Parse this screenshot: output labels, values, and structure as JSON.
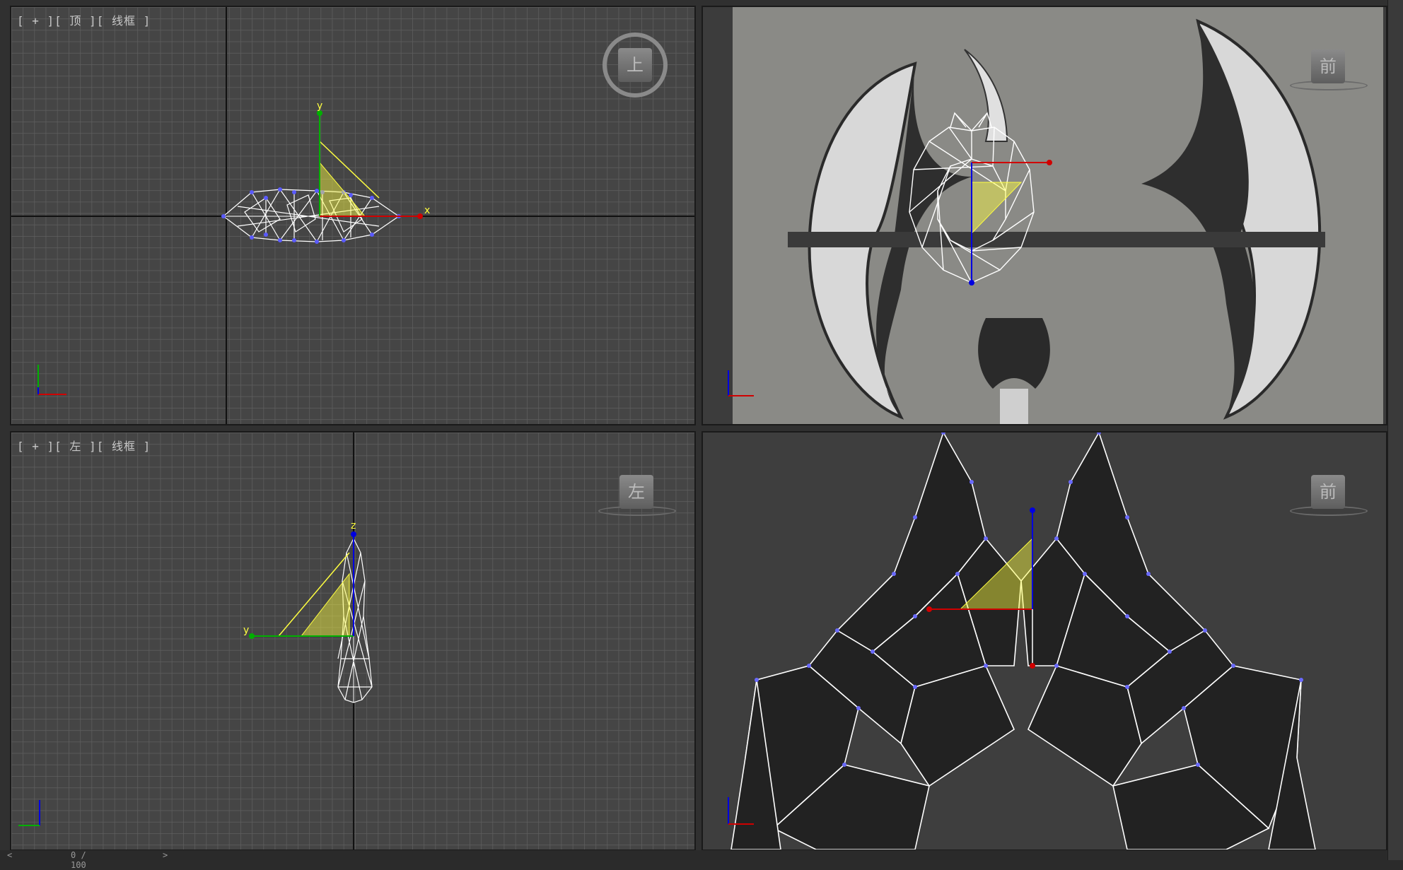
{
  "viewports": {
    "top": {
      "label": "[ + ][ 顶 ][ 线框 ]",
      "cube": "上"
    },
    "front": {
      "cube": "前"
    },
    "left": {
      "label": "[ + ][ 左 ][ 线框 ]",
      "cube": "左"
    },
    "perspective": {
      "cube": "前"
    }
  },
  "axes": {
    "x": "x",
    "y": "y",
    "z": "z"
  },
  "timeline": {
    "frame": "0 / 100",
    "prev": "<",
    "next": ">"
  },
  "colors": {
    "viewport_bg": "#454545",
    "grid": "#5f5f5f",
    "grid_major": "#111111",
    "wire": "#ffffff",
    "vertex": "#5a5aff",
    "gizmo": "#ffff40",
    "axis_x": "#d00000",
    "axis_y": "#00b000",
    "axis_z": "#0000e0"
  }
}
